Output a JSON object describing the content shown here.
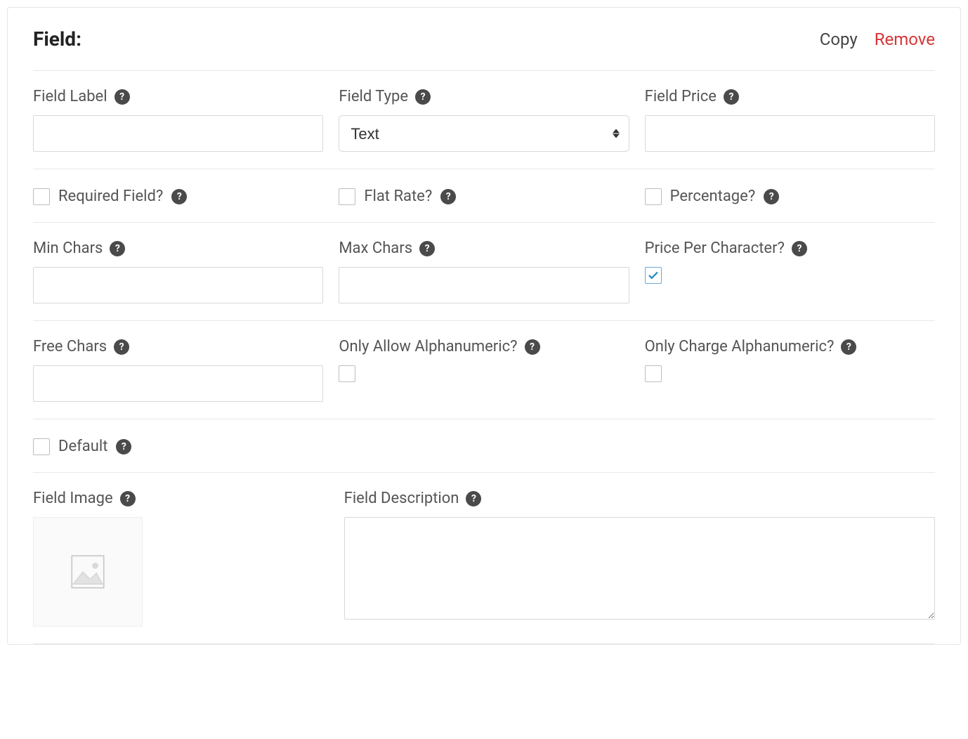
{
  "header": {
    "title": "Field:",
    "copy_label": "Copy",
    "remove_label": "Remove"
  },
  "fields": {
    "field_label": {
      "label": "Field Label",
      "value": ""
    },
    "field_type": {
      "label": "Field Type",
      "value": "Text"
    },
    "field_price": {
      "label": "Field Price",
      "value": ""
    },
    "required_field": {
      "label": "Required Field?",
      "checked": false
    },
    "flat_rate": {
      "label": "Flat Rate?",
      "checked": false
    },
    "percentage": {
      "label": "Percentage?",
      "checked": false
    },
    "min_chars": {
      "label": "Min Chars",
      "value": ""
    },
    "max_chars": {
      "label": "Max Chars",
      "value": ""
    },
    "price_per_char": {
      "label": "Price Per Character?",
      "checked": true
    },
    "free_chars": {
      "label": "Free Chars",
      "value": ""
    },
    "only_allow_alpha": {
      "label": "Only Allow Alphanumeric?",
      "checked": false
    },
    "only_charge_alpha": {
      "label": "Only Charge Alphanumeric?",
      "checked": false
    },
    "default": {
      "label": "Default",
      "checked": false
    },
    "field_image": {
      "label": "Field Image"
    },
    "field_description": {
      "label": "Field Description",
      "value": ""
    }
  }
}
